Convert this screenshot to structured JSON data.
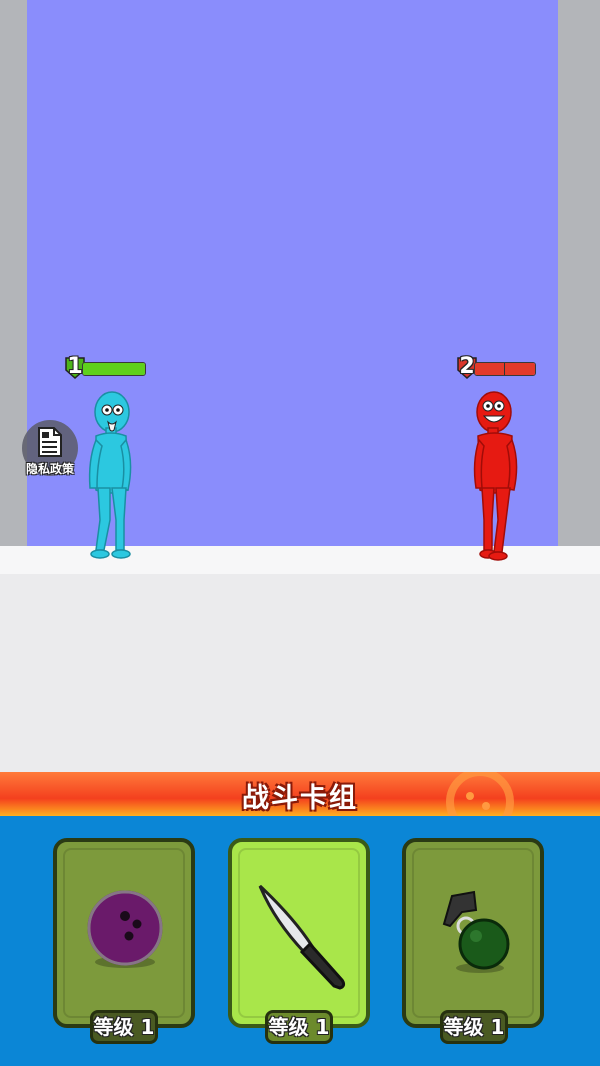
{
  "arena": {
    "player_hp": {
      "label": "1",
      "fill": 1.0,
      "color": "#5fd11c"
    },
    "enemy_hp": {
      "label": "2",
      "fill": 1.0,
      "color": "#e23a2a"
    }
  },
  "privacy_button": {
    "label": "隐私政策",
    "icon": "document-lock-icon"
  },
  "deck": {
    "title": "战斗卡组",
    "cards": [
      {
        "item": "bowling-ball-icon",
        "level": "等级 1",
        "selected": false
      },
      {
        "item": "knife-icon",
        "level": "等级 1",
        "selected": true
      },
      {
        "item": "grenade-icon",
        "level": "等级 1",
        "selected": false
      }
    ]
  },
  "colors": {
    "back_wall": "#8a8dfc",
    "player": "#2cc8e0",
    "enemy": "#e61a12",
    "deck_bg": "#0b86d6"
  }
}
